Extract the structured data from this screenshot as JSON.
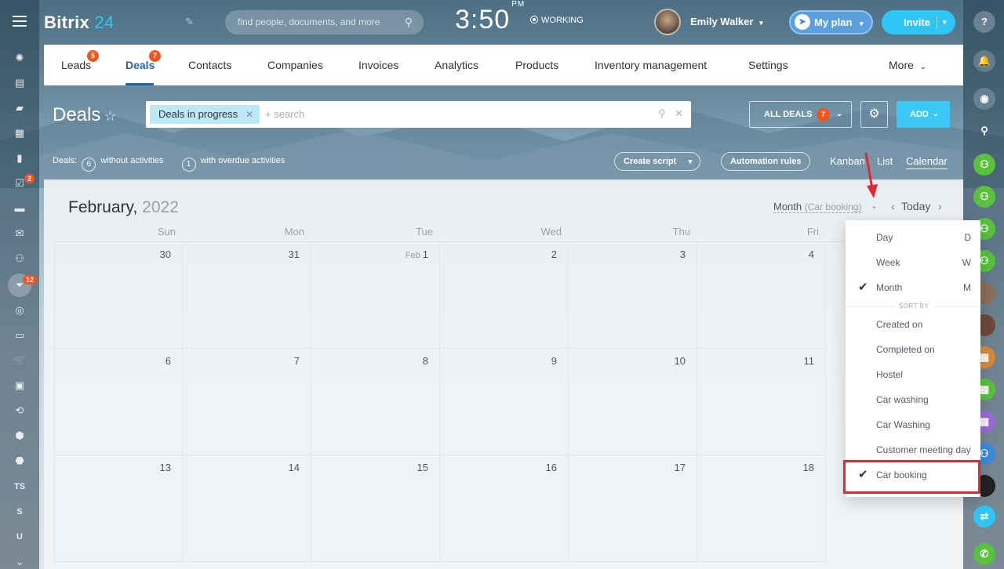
{
  "app": {
    "logo_name": "Bitrix",
    "logo_num": "24",
    "search_placeholder": "find people, documents, and more",
    "time": "3:50",
    "ampm": "PM",
    "working": "WORKING",
    "user_name": "Emily Walker",
    "myplan_label": "My plan",
    "invite_label": "Invite"
  },
  "left_sidebar": {
    "badges": {
      "tasks": "2",
      "crm": "12"
    },
    "text_items": [
      "TS",
      "S",
      "U"
    ]
  },
  "topnav": {
    "items": [
      {
        "label": "Leads",
        "badge": "5"
      },
      {
        "label": "Deals",
        "badge": "7"
      },
      {
        "label": "Contacts"
      },
      {
        "label": "Companies"
      },
      {
        "label": "Invoices"
      },
      {
        "label": "Analytics"
      },
      {
        "label": "Products"
      },
      {
        "label": "Inventory management"
      },
      {
        "label": "Settings"
      },
      {
        "label": "More"
      }
    ],
    "active": "Deals"
  },
  "toolbar": {
    "title": "Deals",
    "filter_chip": "Deals in progress",
    "filter_search_placeholder": "+ search",
    "all_deals_label": "ALL DEALS",
    "all_deals_count": "7",
    "add_label": "ADD"
  },
  "stats": {
    "prefix": "Deals:",
    "without_count": "6",
    "without_label": "without activities",
    "overdue_count": "1",
    "overdue_label": "with overdue activities"
  },
  "actions": {
    "create_script": "Create script",
    "automation_rules": "Automation rules"
  },
  "views": {
    "kanban": "Kanban",
    "list": "List",
    "calendar": "Calendar"
  },
  "calendar": {
    "month": "February,",
    "year": "2022",
    "mode": "Month",
    "mode_sub": "(Car booking)",
    "today": "Today",
    "days_of_week": [
      "Sun",
      "Mon",
      "Tue",
      "Wed",
      "Thu",
      "Fri"
    ],
    "weeks": [
      [
        "30",
        "31",
        "1",
        "2",
        "3",
        "4"
      ],
      [
        "6",
        "7",
        "8",
        "9",
        "10",
        "11"
      ],
      [
        "13",
        "14",
        "15",
        "16",
        "17",
        "18"
      ]
    ],
    "feb_label": "Feb"
  },
  "dropdown": {
    "view_items": [
      {
        "label": "Day",
        "key": "D",
        "checked": false
      },
      {
        "label": "Week",
        "key": "W",
        "checked": false
      },
      {
        "label": "Month",
        "key": "M",
        "checked": true
      }
    ],
    "sort_by_label": "SORT BY",
    "sort_items": [
      {
        "label": "Created on",
        "checked": false
      },
      {
        "label": "Completed on",
        "checked": false
      },
      {
        "label": "Hostel",
        "checked": false
      },
      {
        "label": "Car washing",
        "checked": false
      },
      {
        "label": "Car Washing",
        "checked": false
      },
      {
        "label": "Customer meeting day",
        "checked": false
      },
      {
        "label": "Car booking",
        "checked": true
      }
    ]
  },
  "colors": {
    "accent": "#2fc6f6",
    "active_nav": "#2067b0",
    "badge": "#f0561d",
    "highlight": "#e02930"
  }
}
